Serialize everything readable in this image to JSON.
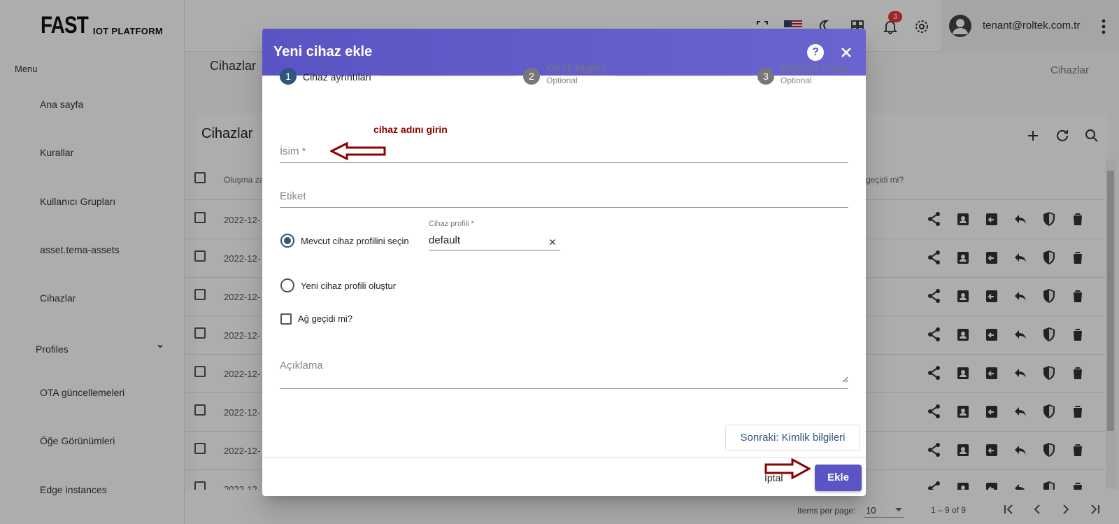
{
  "logo": {
    "big": "FAST",
    "small": "IOT PLATFORM"
  },
  "sidebar": {
    "menu_caption": "Menu",
    "items": [
      {
        "label": "Ana sayfa"
      },
      {
        "label": "Kurallar"
      },
      {
        "label": "Kullanıcı Grupları"
      },
      {
        "label": "asset.tema-assets"
      },
      {
        "label": "Cihazlar"
      },
      {
        "label": "Profiles"
      },
      {
        "label": "OTA güncellemeleri"
      },
      {
        "label": "Öğe Görünümleri"
      },
      {
        "label": "Edge instances"
      }
    ]
  },
  "topbar": {
    "notification_count": "3",
    "user_email": "tenant@roltek.com.tr",
    "icons": [
      "fullscreen-icon",
      "us-flag-icon",
      "moon-icon",
      "dashboard-icon",
      "bell-icon",
      "gear-icon",
      "account-icon",
      "more-vert-icon"
    ]
  },
  "breadcrumb": {
    "left": "Cihazlar",
    "right": "Cihazlar"
  },
  "card": {
    "title": "Cihazlar",
    "actions": [
      "add-icon",
      "refresh-icon",
      "search-icon"
    ]
  },
  "table": {
    "header_left": "Oluşma za",
    "header_right": "geçidi mi?",
    "rows": [
      {
        "date": "2022-12-"
      },
      {
        "date": "2022-12-"
      },
      {
        "date": "2022-12-"
      },
      {
        "date": "2022-12-"
      },
      {
        "date": "2022-12-"
      },
      {
        "date": "2022-12-"
      },
      {
        "date": "2022-12-"
      },
      {
        "date": "2022-12-"
      }
    ]
  },
  "footer": {
    "items_per_page_label": "Items per page:",
    "items_per_page_value": "10",
    "range": "1 – 9 of 9"
  },
  "dialog": {
    "title": "Yeni cihaz ekle",
    "help": "?",
    "steps": [
      {
        "number": "1",
        "label": "Cihaz ayrıntıları",
        "optional": ""
      },
      {
        "number": "2",
        "label": "Kimlik bilgileri",
        "optional": "Optional"
      },
      {
        "number": "3",
        "label": "Kullanıcı Grubu",
        "optional": "Optional"
      }
    ],
    "hint": "cihaz adını girin",
    "name_label": "İsim *",
    "label_label": "Etiket",
    "radio_existing": "Mevcut cihaz profilini seçin",
    "radio_new": "Yeni cihaz profili oluştur",
    "profile_caption": "Cihaz profili *",
    "profile_value": "default",
    "gateway_label": "Ağ geçidi mi?",
    "description_label": "Açıklama",
    "next_button": "Sonraki: Kimlik bilgileri",
    "cancel_button": "İptal",
    "add_button": "Ekle"
  },
  "colors": {
    "dialog_header": "#5b54c4",
    "step_active": "#305680",
    "annotation": "#8b0000"
  }
}
